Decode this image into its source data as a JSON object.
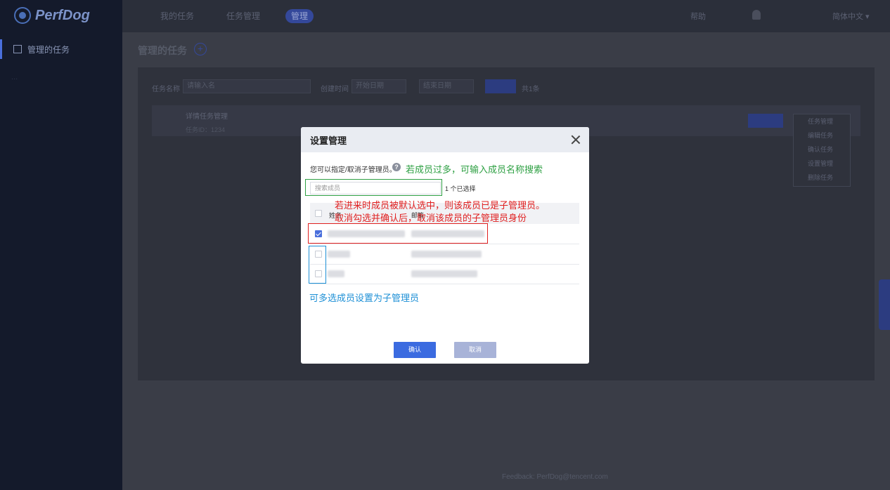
{
  "sidebar": {
    "logo": "PerfDog",
    "items": [
      {
        "label": "管理的任务"
      },
      {
        "label": "..."
      }
    ]
  },
  "topnav": {
    "tabs": [
      {
        "label": "我的任务"
      },
      {
        "label": "任务管理"
      },
      {
        "label": "管理"
      }
    ],
    "right_link": "帮助",
    "language": "简体中文 ▾"
  },
  "page": {
    "title": "管理的任务",
    "filter": {
      "name_label": "任务名称",
      "name_placeholder": "请输入名",
      "time_label": "创建时间",
      "start_placeholder": "开始日期",
      "end_placeholder": "结束日期",
      "total": "共1条"
    },
    "task": {
      "title": "详情任务管理",
      "sub": "任务ID：1234"
    },
    "task_menu": [
      "任务管理",
      "编辑任务",
      "确认任务",
      "设置管理",
      "删除任务"
    ],
    "footer": "Feedback: PerfDog@tencent.com"
  },
  "modal": {
    "title": "设置管理",
    "hint": "您可以指定/取消子管理员。",
    "search_placeholder": "搜索成员",
    "selected_count": "1 个已选择",
    "col_name": "姓名",
    "col_email": "邮箱",
    "confirm": "确认",
    "cancel": "取消"
  },
  "annotations": {
    "search_note": "若成员过多，可输入成员名称搜索",
    "default_note_line1": "若进来时成员被默认选中，则该成员已是子管理员。",
    "default_note_line2": "取消勾选并确认后，取消该成员的子管理员身份",
    "multi_note": "可多选成员设置为子管理员"
  },
  "colors": {
    "accent": "#3b6be0",
    "annotation_green": "#2ea043",
    "annotation_red": "#e02020",
    "annotation_blue": "#1e90d6"
  }
}
